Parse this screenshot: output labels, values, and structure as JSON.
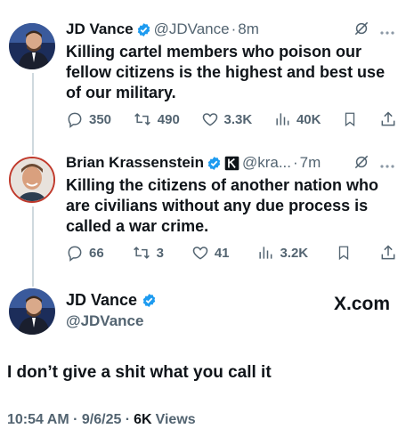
{
  "tweet1": {
    "name": "JD Vance",
    "handle": "@JDVance",
    "time": "8m",
    "text": "Killing cartel members who poison our fellow citizens is the highest and best use of our military.",
    "replies": "350",
    "retweets": "490",
    "likes": "3.3K",
    "views": "40K"
  },
  "tweet2": {
    "name": "Brian Krassenstein",
    "handle": "@kra...",
    "time": "7m",
    "text": "Killing the citizens of another nation who are civilians without any due process is called a war crime.",
    "replies": "66",
    "retweets": "3",
    "likes": "41",
    "views": "3.2K"
  },
  "main": {
    "name": "JD Vance",
    "handle": "@JDVance",
    "brand": "X.com",
    "text": "I don’t give a shit what you call it",
    "timestamp": "10:54 AM · 9/6/25 ·",
    "views_count": "6K",
    "views_label": "Views"
  },
  "separator": "·",
  "colors": {
    "verified": "#1d9bf0",
    "text": "#0f1419",
    "muted": "#536471",
    "thread_line": "#cfd9de"
  },
  "icons": [
    "verified-badge-icon",
    "grok-icon",
    "more-icon",
    "reply-icon",
    "retweet-icon",
    "like-icon",
    "views-icon",
    "bookmark-icon",
    "share-icon",
    "affiliate-badge-icon"
  ]
}
